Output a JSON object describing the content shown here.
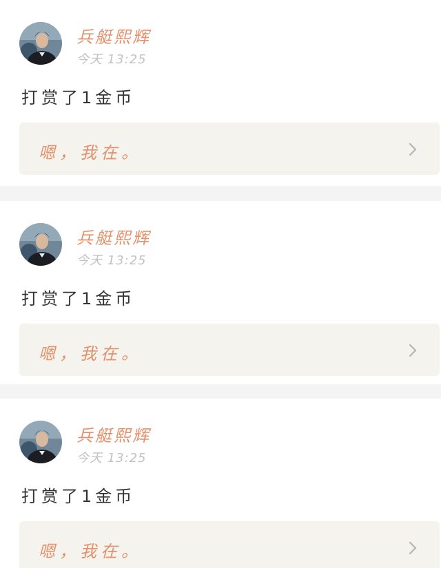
{
  "feed": {
    "items": [
      {
        "user_name": "兵艇熙辉",
        "time": "今天 13:25",
        "action": "打赏了1金币",
        "post_excerpt": "嗯，我在。",
        "avatar_icon": "user-avatar-photo",
        "chevron_icon": "chevron-right-icon"
      },
      {
        "user_name": "兵艇熙辉",
        "time": "今天 13:25",
        "action": "打赏了1金币",
        "post_excerpt": "嗯，我在。",
        "avatar_icon": "user-avatar-photo",
        "chevron_icon": "chevron-right-icon"
      },
      {
        "user_name": "兵艇熙辉",
        "time": "今天 13:25",
        "action": "打赏了1金币",
        "post_excerpt": "嗯，我在。",
        "avatar_icon": "user-avatar-photo",
        "chevron_icon": "chevron-right-icon"
      }
    ]
  },
  "colors": {
    "accent": "#e4906a",
    "muted": "#c2c2c2",
    "text": "#333333",
    "quote_bg": "#f4f3ed",
    "page_bg": "#f4f4f4"
  }
}
